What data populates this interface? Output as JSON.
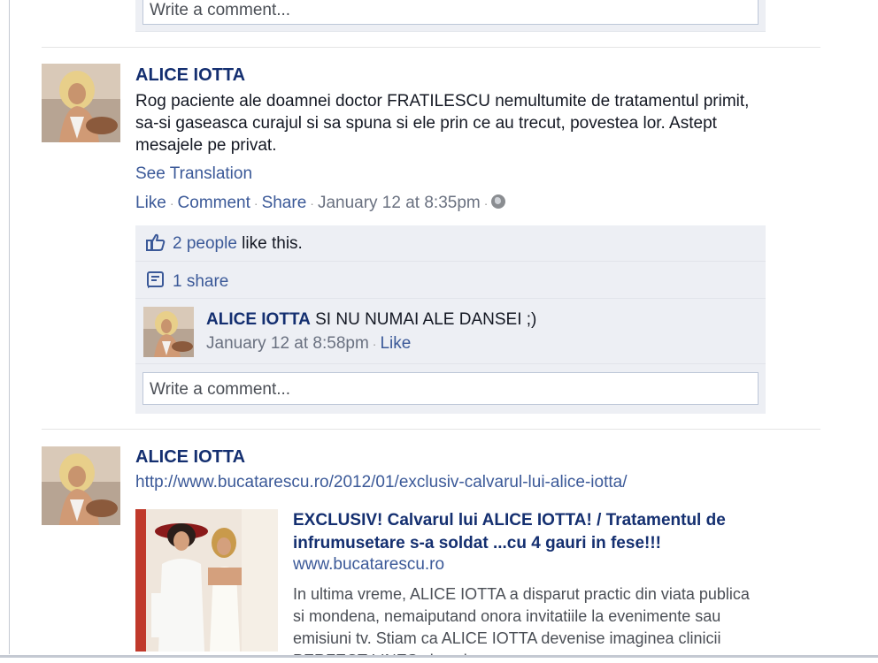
{
  "top": {
    "write_comment_placeholder": "Write a comment..."
  },
  "post1": {
    "author": "ALICE IOTTA",
    "text": "Rog paciente ale doamnei doctor FRATILESCU nemultumite de tratamentul primit, sa-si gaseasca curajul si sa spuna si ele prin ce au trecut, povestea lor. Astept mesajele pe privat.",
    "see_translation": "See Translation",
    "actions": {
      "like": "Like",
      "comment": "Comment",
      "share": "Share",
      "timestamp": "January 12 at 8:35pm",
      "privacy_icon": "globe-icon"
    },
    "likes": {
      "people_link": "2 people",
      "suffix": " like this."
    },
    "shares": "1 share",
    "comment": {
      "author": "ALICE IOTTA",
      "text": " SI NU NUMAI ALE DANSEI ;)",
      "timestamp": "January 12 at 8:58pm",
      "like": "Like"
    },
    "write_comment_placeholder": "Write a comment..."
  },
  "post2": {
    "author": "ALICE IOTTA",
    "url": "http://www.bucatarescu.ro/2012/01/exclusiv-calvarul-lui-alice-iotta/",
    "shared": {
      "title": "EXCLUSIV! Calvarul lui ALICE IOTTA! / Tratamentul de infrumusetare s-a soldat ...cu 4 gauri in fese!!!",
      "domain": "www.bucatarescu.ro",
      "description": "In ultima vreme, ALICE IOTTA a disparut practic din viata publica si mondena, nemaiputand onora invitatiile la evenimente sau emisiuni tv. Stiam ca ALICE IOTTA devenise imaginea clinicii PERFECT LINES si ca, in"
    }
  },
  "colors": {
    "link": "#3b5998",
    "author": "#142f70",
    "ufi_background": "#edeff4",
    "meta": "#6a7180"
  }
}
